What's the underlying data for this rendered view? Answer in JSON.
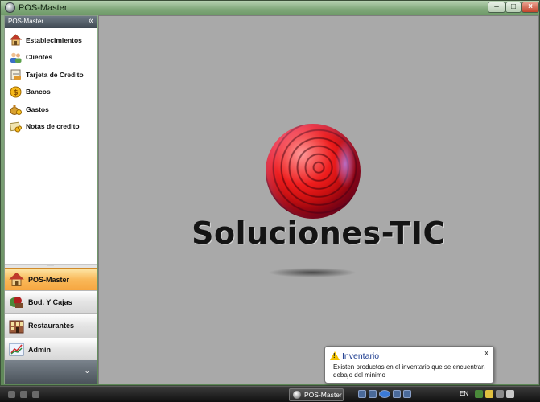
{
  "window": {
    "title": "POS-Master"
  },
  "sidebar": {
    "header": "POS-Master",
    "collapse_glyph": "«",
    "items": [
      {
        "label": "Establecimientos",
        "icon": "home-icon"
      },
      {
        "label": "Clientes",
        "icon": "users-icon"
      },
      {
        "label": "Tarjeta de Credito",
        "icon": "credit-card-icon"
      },
      {
        "label": "Bancos",
        "icon": "coin-icon"
      },
      {
        "label": "Gastos",
        "icon": "money-bag-icon"
      },
      {
        "label": "Notas de credito",
        "icon": "notes-icon"
      }
    ],
    "groups": [
      {
        "label": "POS-Master",
        "icon": "home-icon",
        "active": true
      },
      {
        "label": "Bod. Y Cajas",
        "icon": "warehouse-icon",
        "active": false
      },
      {
        "label": "Restaurantes",
        "icon": "restaurant-icon",
        "active": false
      },
      {
        "label": "Admin",
        "icon": "chart-icon",
        "active": false
      }
    ],
    "footer_chevron": "⌄"
  },
  "main": {
    "logo_text": "Soluciones-TIC"
  },
  "notification": {
    "title": "Inventario",
    "message": "Existen productos en el inventario que se encuentran debajo del minimo",
    "close_glyph": "x"
  },
  "taskbar": {
    "task_label": "POS-Master",
    "language": "EN"
  },
  "colors": {
    "active_group": "#f6a640",
    "canvas": "#a9a9a9",
    "notification_title": "#1d3c8f"
  }
}
